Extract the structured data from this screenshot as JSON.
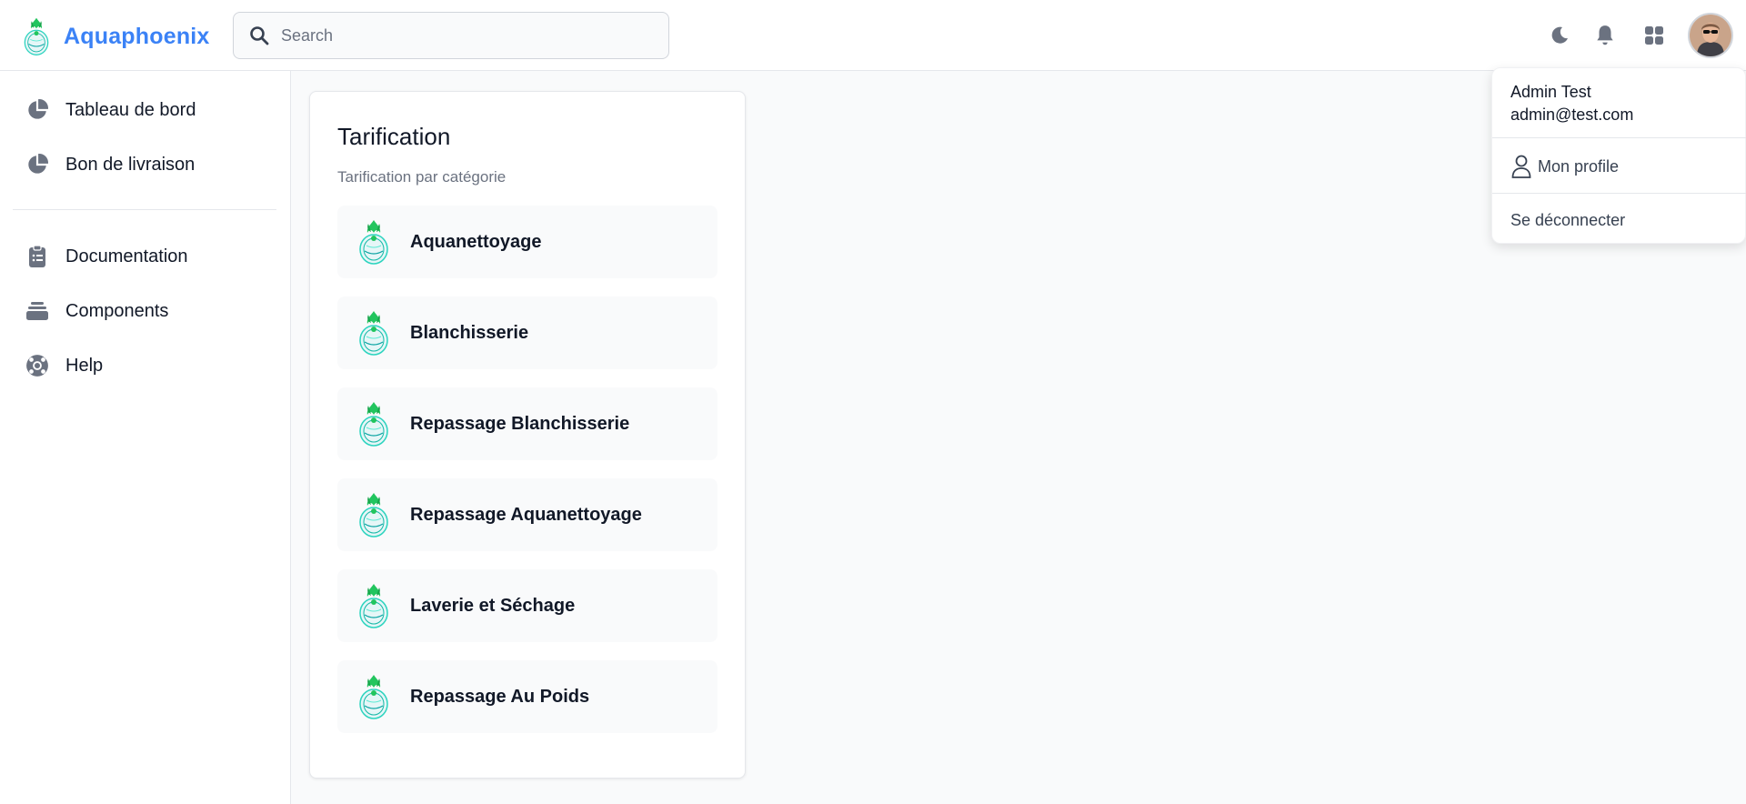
{
  "header": {
    "brand_name": "Aquaphoenix",
    "search_placeholder": "Search",
    "icons": [
      "moon-icon",
      "bell-icon",
      "apps-grid-icon"
    ]
  },
  "sidebar": {
    "items": [
      {
        "label": "Tableau de bord",
        "icon": "pie-chart-icon"
      },
      {
        "label": "Bon de livraison",
        "icon": "pie-chart-icon"
      },
      {
        "label": "Documentation",
        "icon": "clipboard-icon"
      },
      {
        "label": "Components",
        "icon": "stack-icon"
      },
      {
        "label": "Help",
        "icon": "lifebuoy-icon"
      }
    ]
  },
  "card": {
    "title": "Tarification",
    "subtitle": "Tarification par catégorie",
    "categories": [
      {
        "name": "Aquanettoyage"
      },
      {
        "name": "Blanchisserie"
      },
      {
        "name": "Repassage Blanchisserie"
      },
      {
        "name": "Repassage Aquanettoyage"
      },
      {
        "name": "Laverie et Séchage"
      },
      {
        "name": "Repassage Au Poids"
      }
    ]
  },
  "user_menu": {
    "name": "Admin Test",
    "email": "admin@test.com",
    "profile_label": "Mon profile",
    "logout_label": "Se déconnecter"
  },
  "colors": {
    "brand": "#3b82f6",
    "icon_gray": "#6b7280",
    "background": "#f9fafb"
  }
}
